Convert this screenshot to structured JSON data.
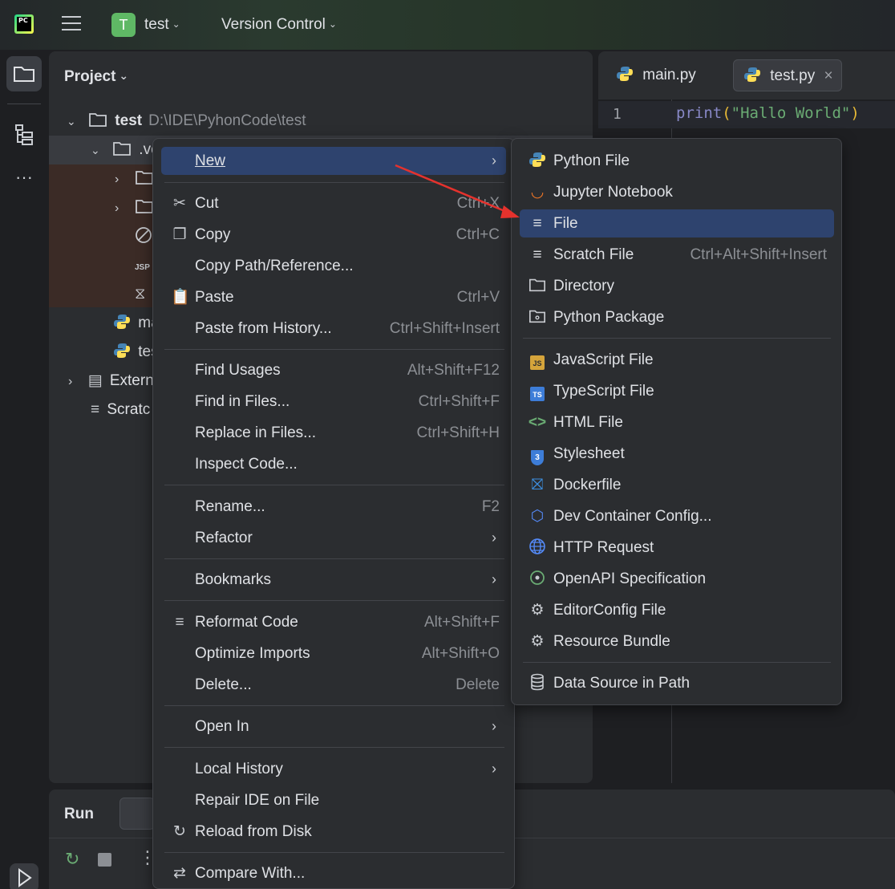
{
  "titlebar": {
    "project_badge": "T",
    "project_name": "test",
    "vcs": "Version Control"
  },
  "project_panel": {
    "title": "Project",
    "tree": [
      {
        "label": "test",
        "path": "D:\\IDE\\PyhonCode\\test"
      },
      {
        "label": ".ve"
      },
      {
        "label": ""
      },
      {
        "label": ""
      },
      {
        "label": ""
      },
      {
        "label": ""
      },
      {
        "label": ""
      },
      {
        "label": "ma"
      },
      {
        "label": "tes"
      },
      {
        "label": "Extern"
      },
      {
        "label": "Scratc"
      }
    ]
  },
  "editor": {
    "tabs": [
      {
        "label": "main.py"
      },
      {
        "label": "test.py"
      }
    ],
    "line_number": "1",
    "code": {
      "fn": "print",
      "open": "(",
      "str": "\"Hallo World\"",
      "close": ")"
    }
  },
  "run_panel": {
    "title": "Run"
  },
  "context_menu": {
    "items": [
      {
        "label": "New",
        "shortcut": "",
        "submenu": true
      },
      {
        "label": "Cut",
        "shortcut": "Ctrl+X"
      },
      {
        "label": "Copy",
        "shortcut": "Ctrl+C"
      },
      {
        "label": "Copy Path/Reference...",
        "shortcut": ""
      },
      {
        "label": "Paste",
        "shortcut": "Ctrl+V"
      },
      {
        "label": "Paste from History...",
        "shortcut": "Ctrl+Shift+Insert"
      },
      {
        "label": "Find Usages",
        "shortcut": "Alt+Shift+F12"
      },
      {
        "label": "Find in Files...",
        "shortcut": "Ctrl+Shift+F"
      },
      {
        "label": "Replace in Files...",
        "shortcut": "Ctrl+Shift+H"
      },
      {
        "label": "Inspect Code...",
        "shortcut": ""
      },
      {
        "label": "Rename...",
        "shortcut": "F2"
      },
      {
        "label": "Refactor",
        "shortcut": "",
        "submenu": true
      },
      {
        "label": "Bookmarks",
        "shortcut": "",
        "submenu": true
      },
      {
        "label": "Reformat Code",
        "shortcut": "Alt+Shift+F"
      },
      {
        "label": "Optimize Imports",
        "shortcut": "Alt+Shift+O"
      },
      {
        "label": "Delete...",
        "shortcut": "Delete"
      },
      {
        "label": "Open In",
        "shortcut": "",
        "submenu": true
      },
      {
        "label": "Local History",
        "shortcut": "",
        "submenu": true
      },
      {
        "label": "Repair IDE on File",
        "shortcut": ""
      },
      {
        "label": "Reload from Disk",
        "shortcut": ""
      },
      {
        "label": "Compare With...",
        "shortcut": ""
      }
    ]
  },
  "new_submenu": {
    "items": [
      {
        "label": "Python File",
        "shortcut": ""
      },
      {
        "label": "Jupyter Notebook",
        "shortcut": ""
      },
      {
        "label": "File",
        "shortcut": ""
      },
      {
        "label": "Scratch File",
        "shortcut": "Ctrl+Alt+Shift+Insert"
      },
      {
        "label": "Directory",
        "shortcut": ""
      },
      {
        "label": "Python Package",
        "shortcut": ""
      },
      {
        "label": "JavaScript File",
        "shortcut": ""
      },
      {
        "label": "TypeScript File",
        "shortcut": ""
      },
      {
        "label": "HTML File",
        "shortcut": ""
      },
      {
        "label": "Stylesheet",
        "shortcut": ""
      },
      {
        "label": "Dockerfile",
        "shortcut": ""
      },
      {
        "label": "Dev Container Config...",
        "shortcut": ""
      },
      {
        "label": "HTTP Request",
        "shortcut": ""
      },
      {
        "label": "OpenAPI Specification",
        "shortcut": ""
      },
      {
        "label": "EditorConfig File",
        "shortcut": ""
      },
      {
        "label": "Resource Bundle",
        "shortcut": ""
      },
      {
        "label": "Data Source in Path",
        "shortcut": ""
      }
    ]
  },
  "colors": {
    "selection": "#2e436e",
    "arrow": "#e5322d",
    "accent_green": "#5fb865"
  }
}
